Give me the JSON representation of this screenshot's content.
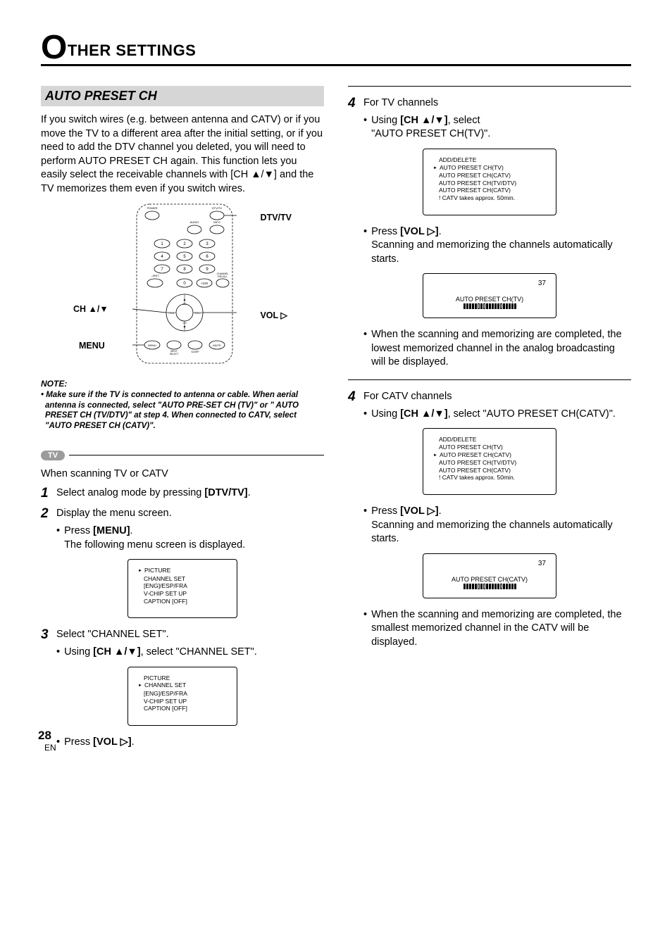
{
  "chapter": {
    "big_letter": "O",
    "rest": "THER SETTINGS"
  },
  "section_title": "AUTO PRESET CH",
  "intro": "If you switch wires (e.g. between antenna and CATV) or if you move the TV to a different area after the initial setting, or if you need to add the DTV channel you deleted, you will need to perform AUTO PRESET CH again. This function lets you easily select the receivable channels with [CH ▲/▼] and the TV memorizes them even if you switch wires.",
  "remote_labels": {
    "dtv_tv": "DTV/TV",
    "ch": "CH ▲/▼",
    "vol": "VOL ▷",
    "menu": "MENU"
  },
  "remote_btn_texts": {
    "power": "POWER",
    "dtvtv": "DTV/TV",
    "audio": "AUDIO",
    "info": "INFO",
    "ent": "–/ENT",
    "plus100": "+100",
    "recall": "CHANNEL\nRECALL",
    "vol_minus": "▽VOL",
    "vol_plus": "VOL▷",
    "ch_up": "▲",
    "ch_dn": "▼",
    "ch_lbl": "CH",
    "menu": "MENU",
    "input": "INPUT\nSELECT",
    "sleep": "SLEEP",
    "mute": "MUTE"
  },
  "note": {
    "heading": "NOTE:",
    "body": "• Make sure if the TV is connected to antenna or cable. When aerial antenna is connected, select \"AUTO PRE-SET CH (TV)\" or \" AUTO PRESET CH (TV/DTV)\" at step 4. When connected to CATV, select \"AUTO PRESET CH (CATV)\"."
  },
  "tv_badge": "TV",
  "scan_intro": "When scanning TV or CATV",
  "step1": {
    "n": "1",
    "text": "Select analog mode by pressing [DTV/TV]."
  },
  "step2": {
    "n": "2",
    "text": "Display the menu screen.",
    "bul1a": "Press ",
    "bul1b": "[MENU]",
    "bul1c": ".",
    "bul2": "The following menu screen is displayed."
  },
  "menu_osd": {
    "l1": "PICTURE",
    "l2": "CHANNEL SET",
    "l3": "[ENG]/ESP/FRA",
    "l4": "V-CHIP SET UP",
    "l5": "CAPTION [OFF]"
  },
  "step3": {
    "n": "3",
    "text": "Select \"CHANNEL SET\".",
    "bul_a": "Using ",
    "bul_b": "[CH ▲/▼]",
    "bul_c": ", select \"CHANNEL SET\"."
  },
  "channel_osd": {
    "l1": "PICTURE",
    "l2": "CHANNEL SET",
    "l3": "[ENG]/ESP/FRA",
    "l4": "V-CHIP SET UP",
    "l5": "CAPTION [OFF]"
  },
  "step3_press": {
    "a": "Press ",
    "b": "[VOL ▷]",
    "c": "."
  },
  "step4tv": {
    "n": "4",
    "text": "For TV channels",
    "bul_a": "Using ",
    "bul_b": "[CH ▲/▼]",
    "bul_c": ", select",
    "bul_d": "\"AUTO PRESET CH(TV)\"."
  },
  "ch_osd_tv": {
    "l1": "ADD/DELETE",
    "l2": "AUTO PRESET CH(TV)",
    "l3": "AUTO PRESET CH(CATV)",
    "l4": "AUTO PRESET CH(TV/DTV)",
    "l5": "AUTO PRESET CH(CATV)",
    "l6": "! CATV takes approx. 50min."
  },
  "tv_press": {
    "a": "Press ",
    "b": "[VOL ▷]",
    "c": "."
  },
  "tv_scan": "Scanning and memorizing the channels automatically starts.",
  "scan_osd_tv": {
    "num": "37",
    "label": "AUTO PRESET CH(TV)"
  },
  "tv_done": "When the scanning and memorizing are completed, the lowest memorized channel in the analog broadcasting will be displayed.",
  "step4catv": {
    "n": "4",
    "text": "For CATV channels",
    "bul_a": "Using ",
    "bul_b": "[CH ▲/▼]",
    "bul_c": ", select \"AUTO PRESET CH(CATV)\"."
  },
  "ch_osd_catv": {
    "l1": "ADD/DELETE",
    "l2": "AUTO PRESET CH(TV)",
    "l3": "AUTO PRESET CH(CATV)",
    "l4": "AUTO PRESET CH(TV/DTV)",
    "l5": "AUTO PRESET CH(CATV)",
    "l6": "! CATV takes approx. 50min."
  },
  "catv_press": {
    "a": "Press ",
    "b": "[VOL ▷]",
    "c": "."
  },
  "catv_scan": "Scanning and memorizing the channels automatically starts.",
  "scan_osd_catv": {
    "num": "37",
    "label": "AUTO PRESET CH(CATV)"
  },
  "catv_done": "When the scanning and memorizing are completed, the smallest memorized channel in the CATV will be displayed.",
  "page_number": "28",
  "page_lang": "EN"
}
